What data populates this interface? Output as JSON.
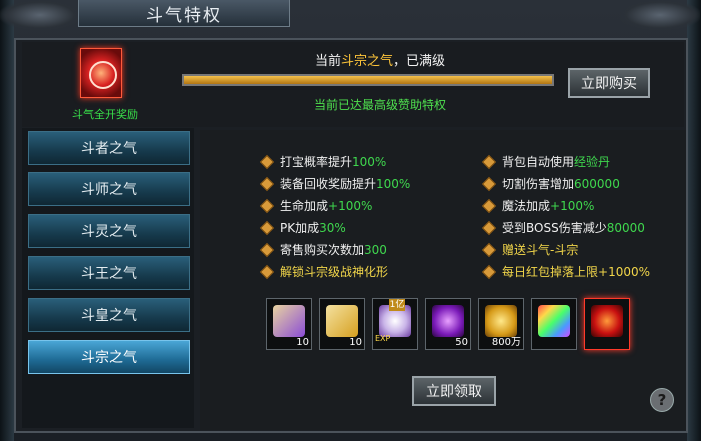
{
  "window": {
    "title": "斗气特权"
  },
  "top": {
    "status_prefix": "当前",
    "status_level": "斗宗之气",
    "status_suffix": "，已满级",
    "progress": 1.0,
    "progress_label": "当前已达最高级赞助特权",
    "gift_label": "斗气全开奖励",
    "buy_label": "立即购买"
  },
  "sidebar": {
    "items": [
      {
        "label": "斗者之气",
        "active": false
      },
      {
        "label": "斗师之气",
        "active": false
      },
      {
        "label": "斗灵之气",
        "active": false
      },
      {
        "label": "斗王之气",
        "active": false
      },
      {
        "label": "斗皇之气",
        "active": false
      },
      {
        "label": "斗宗之气",
        "active": true
      }
    ]
  },
  "perks": {
    "left": [
      {
        "text": "打宝概率提升",
        "value": "100%"
      },
      {
        "text": "装备回收奖励提升",
        "value": "100%"
      },
      {
        "text": "生命加成",
        "value": "+100%"
      },
      {
        "text": "PK加成",
        "value": "30%"
      },
      {
        "text": "寄售购买次数加",
        "value": "300"
      },
      {
        "text": "解锁斗宗级战神化形",
        "value": ""
      }
    ],
    "right": [
      {
        "text": "背包自动使用",
        "value": "经验丹"
      },
      {
        "text": "切割伤害增加",
        "value": "600000"
      },
      {
        "text": "魔法加成",
        "value": "+100%"
      },
      {
        "text": "受到BOSS伤害减少",
        "value": "80000"
      },
      {
        "text": "赠送斗气-斗宗",
        "value": ""
      },
      {
        "text": "每日红包掉落上限",
        "value": "+1000%"
      }
    ]
  },
  "rewards": [
    {
      "icon": "purple-scroll-icon",
      "qty": "10"
    },
    {
      "icon": "gold-scroll-icon",
      "qty": "10"
    },
    {
      "icon": "exp-orb-icon",
      "badge": "1亿",
      "exp": "EXP"
    },
    {
      "icon": "purple-orb-icon",
      "qty": "50"
    },
    {
      "icon": "gold-ingot-icon",
      "qty": "800万"
    },
    {
      "icon": "rainbow-card-icon"
    },
    {
      "icon": "red-dragon-icon"
    }
  ],
  "claim_label": "立即领取",
  "help_label": "?"
}
